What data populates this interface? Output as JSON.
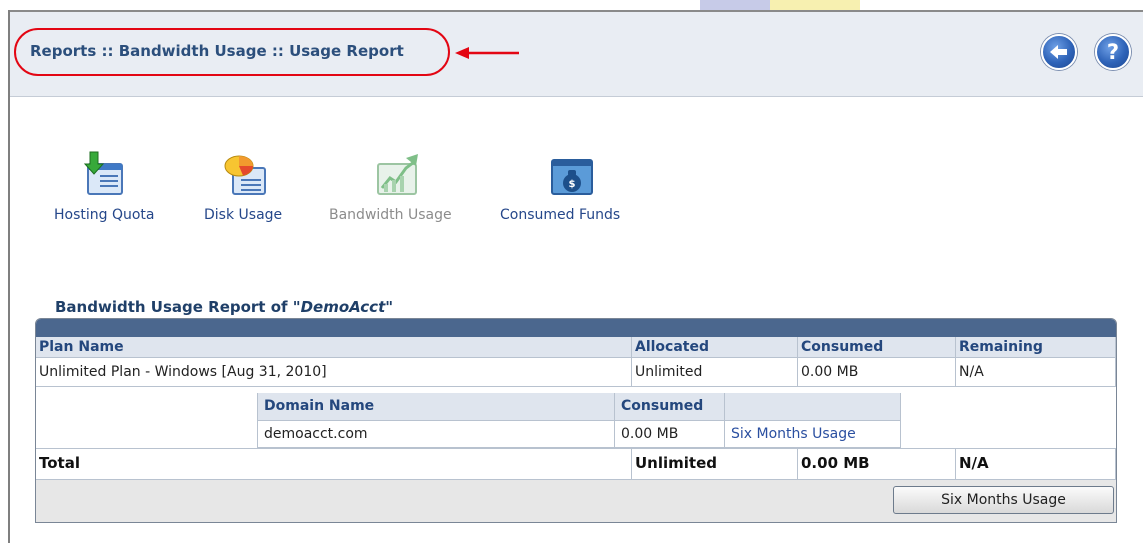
{
  "header": {
    "breadcrumb": "Reports :: Bandwidth Usage :: Usage Report",
    "back_icon": "back-arrow-icon",
    "help_icon": "help-icon",
    "help_glyph": "?"
  },
  "nav": {
    "items": [
      {
        "label": "Hosting Quota",
        "icon": "hosting-quota-icon"
      },
      {
        "label": "Disk Usage",
        "icon": "disk-usage-icon"
      },
      {
        "label": "Bandwidth Usage",
        "icon": "bandwidth-usage-icon",
        "current": true
      },
      {
        "label": "Consumed Funds",
        "icon": "consumed-funds-icon"
      }
    ]
  },
  "report": {
    "title_prefix": "Bandwidth Usage Report of ",
    "account": "\"DemoAcct\"",
    "columns": [
      "Plan Name",
      "Allocated",
      "Consumed",
      "Remaining"
    ],
    "plan_row": {
      "plan_name": "Unlimited Plan - Windows [Aug 31, 2010]",
      "allocated": "Unlimited",
      "consumed": "0.00 MB",
      "remaining": "N/A"
    },
    "domain_columns": [
      "Domain Name",
      "Consumed"
    ],
    "domain_row": {
      "domain": "demoacct.com",
      "consumed": "0.00 MB",
      "link": "Six Months Usage"
    },
    "total_row": {
      "label": "Total",
      "allocated": "Unlimited",
      "consumed": "0.00 MB",
      "remaining": "N/A"
    },
    "button": "Six Months Usage"
  },
  "colors": {
    "breadcrumb": "#2c4f7c",
    "annotation": "#e30613",
    "table_header_bar": "#4b678e",
    "link": "#25478a"
  }
}
